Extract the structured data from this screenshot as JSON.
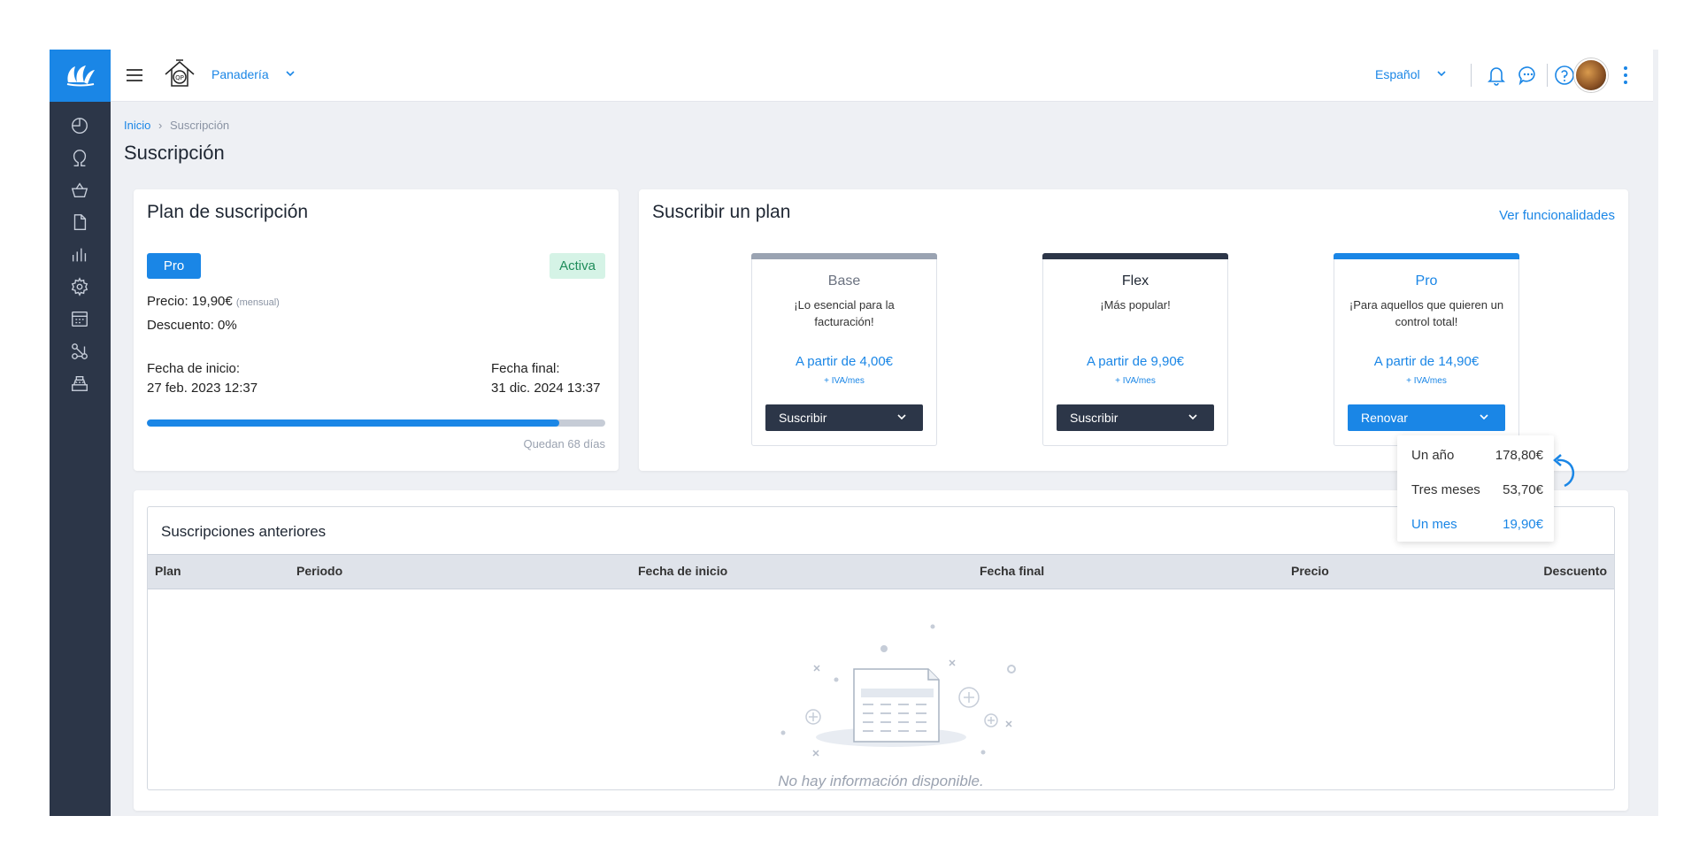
{
  "topbar": {
    "company_name": "Panadería",
    "language": "Español"
  },
  "breadcrumb": {
    "home": "Inicio",
    "separator": "›",
    "current": "Suscripción"
  },
  "page_title": "Suscripción",
  "current_plan": {
    "title": "Plan de suscripción",
    "plan_badge": "Pro",
    "status_badge": "Activa",
    "price_label": "Precio: 19,90€",
    "price_period": "(mensual)",
    "discount_label": "Descuento: 0%",
    "start_label": "Fecha de inicio:",
    "start_value": "27 feb. 2023 12:37",
    "end_label": "Fecha final:",
    "end_value": "31 dic. 2024 13:37",
    "progress_fraction": 0.9,
    "remaining": "Quedan 68 días"
  },
  "subscribe": {
    "title": "Suscribir un plan",
    "features_link": "Ver funcionalidades",
    "plans": [
      {
        "name": "Base",
        "tagline": "¡Lo esencial para la facturación!",
        "price": "A partir de 4,00€",
        "tax": "+ IVA/mes",
        "button": "Suscribir",
        "bar_color": "#9aa3b2",
        "name_color": "#6b7280"
      },
      {
        "name": "Flex",
        "tagline": "¡Más popular!",
        "price": "A partir de 9,90€",
        "tax": "+ IVA/mes",
        "button": "Suscribir",
        "bar_color": "#2c3648",
        "name_color": "#1f2733"
      },
      {
        "name": "Pro",
        "tagline": "¡Para aquellos que quieren un control total!",
        "price": "A partir de 14,90€",
        "tax": "+ IVA/mes",
        "button": "Renovar",
        "bar_color": "#1a86e6",
        "name_color": "#1a86e6"
      }
    ],
    "renew_options": [
      {
        "label": "Un año",
        "price": "178,80€",
        "selected": false
      },
      {
        "label": "Tres meses",
        "price": "53,70€",
        "selected": false
      },
      {
        "label": "Un mes",
        "price": "19,90€",
        "selected": true
      }
    ]
  },
  "previous": {
    "title": "Suscripciones anteriores",
    "columns": [
      "Plan",
      "Periodo",
      "Fecha de inicio",
      "Fecha final",
      "Precio",
      "Descuento"
    ],
    "empty_message": "No hay información disponible."
  },
  "colors": {
    "accent": "#1a86e6",
    "sidebar": "#2c3648",
    "active_badge_bg": "#d5f3e6"
  }
}
